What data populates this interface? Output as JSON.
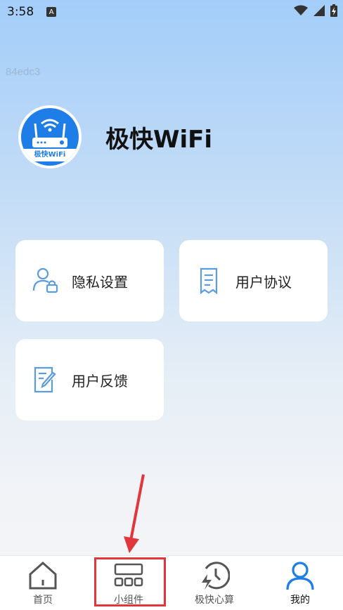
{
  "status_bar": {
    "time": "3:58",
    "notification_icon": "a-letter-icon",
    "icons": [
      "wifi-icon",
      "signal-icon",
      "battery-charging-icon"
    ]
  },
  "debug_text": "84edc3",
  "profile": {
    "avatar_label": "极快WiFi",
    "app_name": "极快WiFi"
  },
  "cards": [
    {
      "label": "隐私设置",
      "icon": "user-lock-icon"
    },
    {
      "label": "用户协议",
      "icon": "document-icon"
    },
    {
      "label": "用户反馈",
      "icon": "edit-note-icon"
    }
  ],
  "tabs": [
    {
      "label": "首页",
      "icon": "home-icon",
      "active": false
    },
    {
      "label": "小组件",
      "icon": "widget-icon",
      "active": false
    },
    {
      "label": "极快心算",
      "icon": "lightning-clock-icon",
      "active": false
    },
    {
      "label": "我的",
      "icon": "person-icon",
      "active": true
    }
  ],
  "colors": {
    "accent": "#1f7de8",
    "icon_blue": "#5b9be0",
    "highlight_red": "#e0363c"
  }
}
